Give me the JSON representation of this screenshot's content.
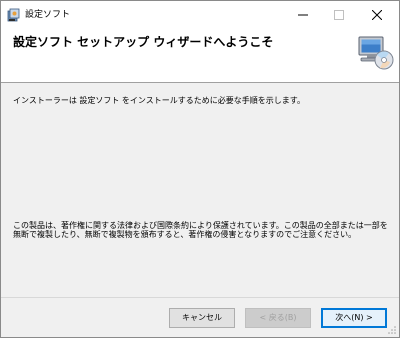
{
  "window": {
    "title": "設定ソフト"
  },
  "controls": {
    "minimize_icon": "minimize-icon",
    "maximize_icon": "maximize-icon",
    "close_icon": "close-icon"
  },
  "header": {
    "title": "設定ソフト セットアップ ウィザードへようこそ",
    "icon": "computer-cd-icon"
  },
  "body": {
    "intro": "インストーラーは 設定ソフト をインストールするために必要な手順を示します。",
    "copyright": "この製品は、著作権に関する法律および国際条約により保護されています。この製品の全部または一部を無断で複製したり、無断で複製物を頒布すると、著作権の侵害となりますのでご注意ください。"
  },
  "buttons": {
    "cancel": "キャンセル",
    "back": "< 戻る(B)",
    "next": "次へ(N) >"
  },
  "colors": {
    "accent": "#0078d7",
    "window_bg": "#f0f0f0"
  }
}
